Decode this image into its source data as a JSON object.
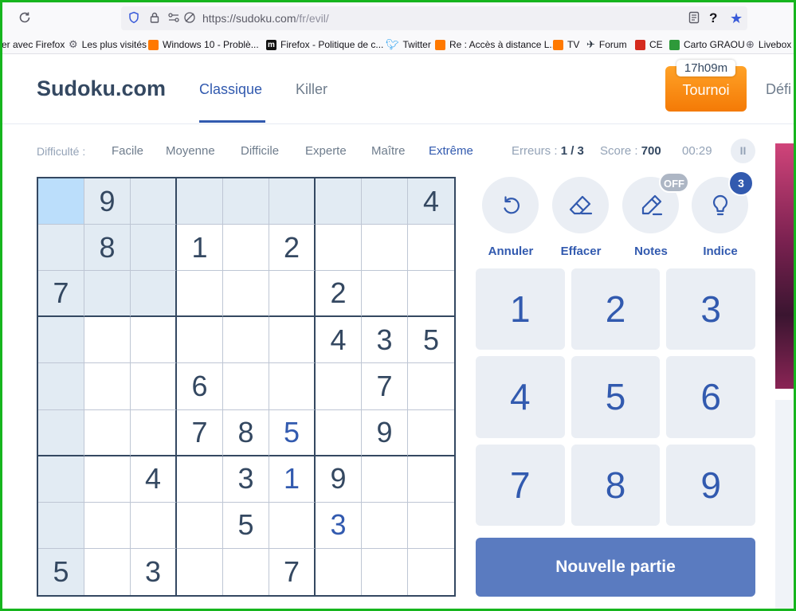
{
  "browser": {
    "url_host": "https://sudoku.com",
    "url_path": "/fr/evil/",
    "help_glyph": "?",
    "star_glyph": "★"
  },
  "bookmarks": [
    {
      "label": "er avec Firefox"
    },
    {
      "label": "Les plus visités"
    },
    {
      "label": "Windows 10 - Problè..."
    },
    {
      "label": "Firefox - Politique de c..."
    },
    {
      "label": "Twitter"
    },
    {
      "label": "Re : Accès à distance L..."
    },
    {
      "label": "TV"
    },
    {
      "label": "Forum"
    },
    {
      "label": "CE"
    },
    {
      "label": "Carto GRAOU"
    },
    {
      "label": "Livebox"
    }
  ],
  "header": {
    "logo": "Sudoku.com",
    "tabs": [
      {
        "label": "Classique"
      },
      {
        "label": "Killer"
      }
    ],
    "tournoi_label": "Tournoi",
    "tournoi_timer": "17h09m",
    "defi_label": "Défi"
  },
  "difficulty": {
    "label": "Difficulté :",
    "levels": [
      "Facile",
      "Moyenne",
      "Difficile",
      "Experte",
      "Maître",
      "Extrême"
    ],
    "active": "Extrême"
  },
  "stats": {
    "errors_label": "Erreurs :",
    "errors_value": "1 / 3",
    "score_label": "Score :",
    "score_value": "700",
    "timer": "00:29",
    "pause_glyph": "II"
  },
  "grid": {
    "rows": [
      [
        "",
        "9",
        "",
        "",
        "",
        "",
        "",
        "",
        "4"
      ],
      [
        "",
        "8",
        "",
        "1",
        "",
        "2",
        "",
        "",
        ""
      ],
      [
        "7",
        "",
        "",
        "",
        "",
        "",
        "2",
        "",
        ""
      ],
      [
        "",
        "",
        "",
        "",
        "",
        "",
        "4",
        "3",
        "5"
      ],
      [
        "",
        "",
        "",
        "6",
        "",
        "",
        "",
        "7",
        ""
      ],
      [
        "",
        "",
        "",
        "7",
        "8",
        "5",
        "",
        "9",
        ""
      ],
      [
        "",
        "",
        "4",
        "",
        "3",
        "1",
        "9",
        "",
        ""
      ],
      [
        "",
        "",
        "",
        "",
        "5",
        "",
        "3",
        "",
        ""
      ],
      [
        "5",
        "",
        "3",
        "",
        "",
        "7",
        "",
        "",
        ""
      ]
    ],
    "user_entries": [
      [
        5,
        5
      ],
      [
        6,
        5
      ],
      [
        7,
        6
      ]
    ],
    "selected": [
      0,
      0
    ]
  },
  "actions": {
    "undo": "Annuler",
    "erase": "Effacer",
    "notes": "Notes",
    "notes_badge": "OFF",
    "hint": "Indice",
    "hint_badge": "3"
  },
  "numpad": [
    "1",
    "2",
    "3",
    "4",
    "5",
    "6",
    "7",
    "8",
    "9"
  ],
  "new_game_label": "Nouvelle partie",
  "colors": {
    "accent": "#325aaf",
    "text": "#344861",
    "highlight": "#e2ebf3",
    "selected": "#bbdefb",
    "tournoi": "#f47a06",
    "frame": "#16b51e"
  }
}
